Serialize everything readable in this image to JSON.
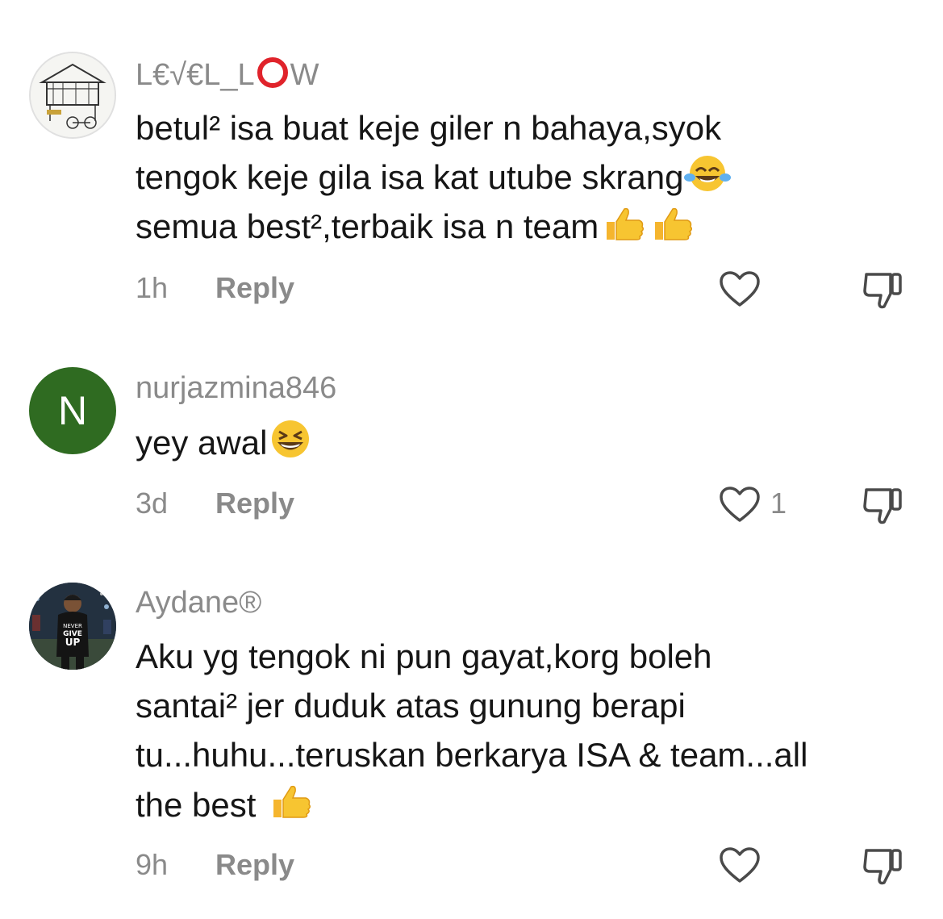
{
  "comments": [
    {
      "username_prefix": "L€√€L_L",
      "username_suffix": "W",
      "lines": [
        "betul² isa buat keje giler n bahaya,syok",
        "tengok keje gila isa kat utube skrang",
        "semua best²,terbaik isa n team"
      ],
      "time": "1h",
      "reply": "Reply",
      "likes": ""
    },
    {
      "username": "nurjazmina846",
      "avatar_letter": "N",
      "lines": [
        "yey awal"
      ],
      "time": "3d",
      "reply": "Reply",
      "likes": "1"
    },
    {
      "username": "Aydane®",
      "lines": [
        "Aku yg tengok ni pun gayat,korg boleh",
        "santai² jer duduk atas gunung berapi",
        "tu...huhu...teruskan berkarya ISA & team...all",
        "the best"
      ],
      "avatar_shirt_text": "NEVER GIVE UP",
      "time": "9h",
      "reply": "Reply",
      "likes": ""
    }
  ],
  "icons": {
    "like": "heart-outline-icon",
    "dislike": "thumbs-down-outline-icon",
    "emoji_laugh": "tears-of-joy-emoji",
    "emoji_thumbs": "thumbs-up-emoji",
    "emoji_grin": "grinning-squinting-emoji"
  },
  "colors": {
    "username": "#8a8a8a",
    "text": "#161616",
    "avatar_green": "#2f6b21",
    "username_circle": "#e0232b"
  }
}
